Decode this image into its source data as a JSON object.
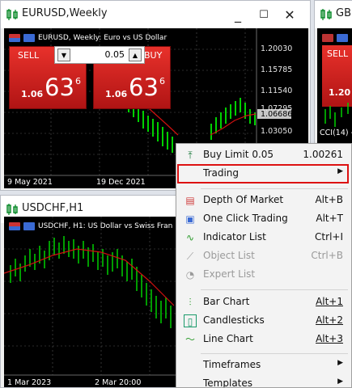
{
  "windows": {
    "eurusd": {
      "title": "EURUSD,Weekly",
      "minimize": "_",
      "maximize": "☐",
      "close": "✕",
      "info": "EURUSD, Weekly:  Euro vs US Dollar",
      "prices": [
        "1.20030",
        "1.15785",
        "1.11540",
        "1.07295",
        "1.06686",
        "1.03050"
      ],
      "dates": [
        "9 May 2021",
        "19 Dec 2021"
      ]
    },
    "gbp": {
      "title": "GBP",
      "sell": "SELL",
      "partial_price": "1.20",
      "cci": "CCI(14) -"
    },
    "usdchf": {
      "title": "USDCHF,H1",
      "info": "USDCHF, H1:  US Dollar vs Swiss Fran",
      "dates": [
        "1 Mar 2023",
        "2 Mar 20:00"
      ]
    }
  },
  "trade_panel": {
    "sell_label": "SELL",
    "buy_label": "BUY",
    "volume": "0.05",
    "sell_small": "1.06",
    "sell_big": "63",
    "sell_sup": "6",
    "buy_small": "1.06",
    "buy_big": "63",
    "buy_sup": "6"
  },
  "colors": {
    "sell_red": "#d42020",
    "candles": "#00d000",
    "ma_line": "#d01010",
    "highlight": "#d11111"
  },
  "context_menu": {
    "items": [
      {
        "icon": "buy-limit-icon",
        "label": "Buy Limit 0.05",
        "shortcut": "1.00261"
      },
      {
        "label": "Trading",
        "submenu": true,
        "highlighted": true
      },
      {
        "icon": "depth-of-market-icon",
        "label": "Depth Of Market",
        "shortcut": "Alt+B"
      },
      {
        "icon": "one-click-trading-icon",
        "label": "One Click Trading",
        "shortcut": "Alt+T"
      },
      {
        "icon": "indicator-list-icon",
        "label": "Indicator List",
        "shortcut": "Ctrl+I"
      },
      {
        "icon": "object-list-icon",
        "label": "Object List",
        "shortcut": "Ctrl+B",
        "disabled": true
      },
      {
        "icon": "expert-list-icon",
        "label": "Expert List",
        "disabled": true
      },
      {
        "icon": "bar-chart-icon",
        "label": "Bar Chart",
        "shortcut": "Alt+1"
      },
      {
        "icon": "candlesticks-icon",
        "label": "Candlesticks",
        "shortcut": "Alt+2"
      },
      {
        "icon": "line-chart-icon",
        "label": "Line Chart",
        "shortcut": "Alt+3"
      },
      {
        "label": "Timeframes",
        "submenu": true
      },
      {
        "label": "Templates",
        "submenu": true
      }
    ]
  }
}
